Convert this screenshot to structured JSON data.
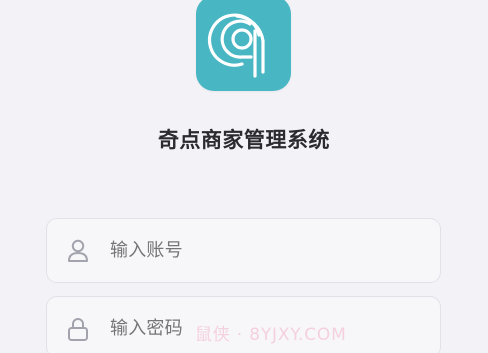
{
  "app": {
    "title": "奇点商家管理系统"
  },
  "logo": {
    "icon": "qidian-logo-icon",
    "background_color": "#48b6c3",
    "foreground_color": "#ffffff"
  },
  "login_form": {
    "account": {
      "icon": "user-icon",
      "placeholder": "输入账号"
    },
    "password": {
      "icon": "lock-icon",
      "placeholder": "输入密码"
    }
  },
  "watermark": {
    "text": "鼠侠 · 8YJXY.COM"
  }
}
